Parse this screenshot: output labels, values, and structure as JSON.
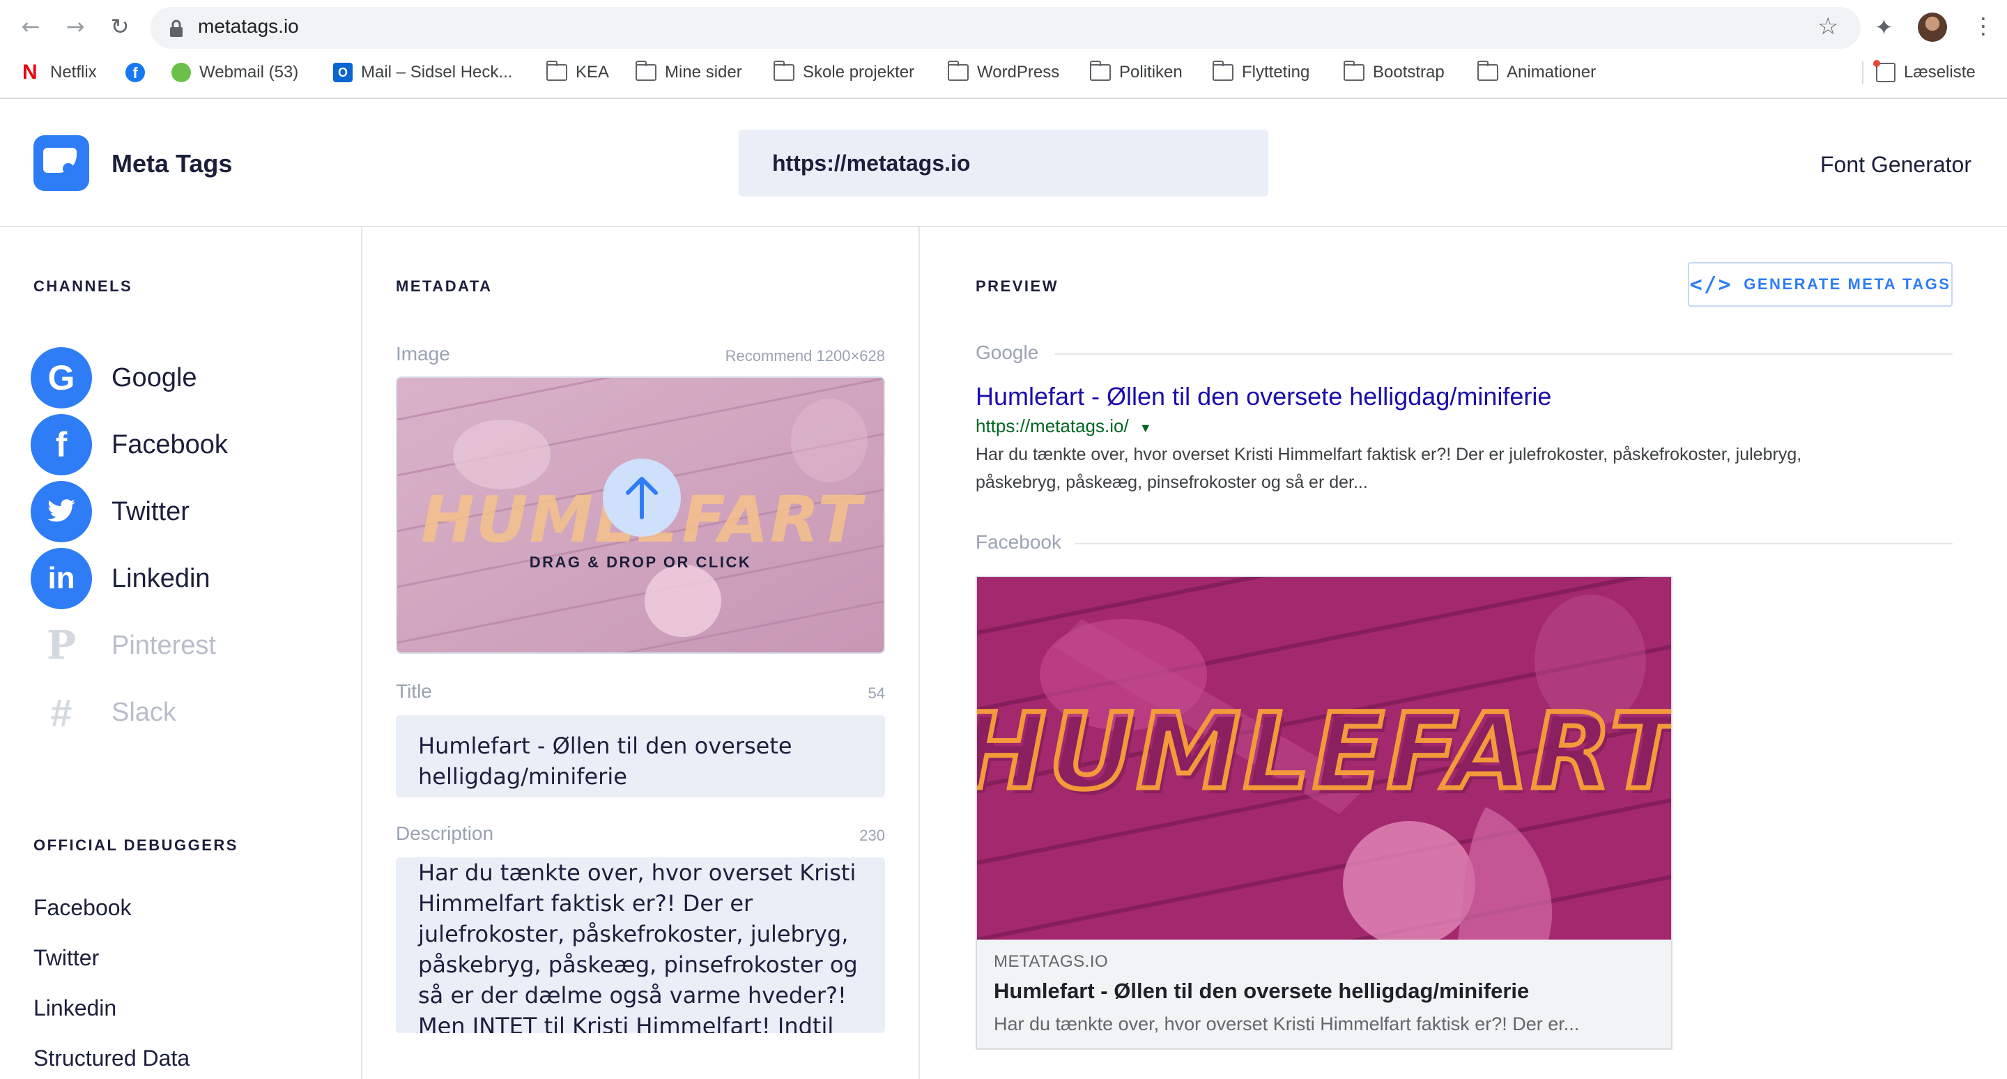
{
  "browser": {
    "url": "metatags.io",
    "bookmarks": [
      {
        "label": "Netflix",
        "icon": "netflix-icon"
      },
      {
        "label": "",
        "icon": "facebook-icon"
      },
      {
        "label": "Webmail (53)",
        "icon": "webmail-icon"
      },
      {
        "label": "Mail – Sidsel Heck...",
        "icon": "outlook-icon"
      },
      {
        "label": "KEA",
        "icon": "folder-icon"
      },
      {
        "label": "Mine sider",
        "icon": "folder-icon"
      },
      {
        "label": "Skole projekter",
        "icon": "folder-icon"
      },
      {
        "label": "WordPress",
        "icon": "folder-icon"
      },
      {
        "label": "Politiken",
        "icon": "folder-icon"
      },
      {
        "label": "Flytteting",
        "icon": "folder-icon"
      },
      {
        "label": "Bootstrap",
        "icon": "folder-icon"
      },
      {
        "label": "Animationer",
        "icon": "folder-icon"
      }
    ],
    "reading_list": "Læseliste"
  },
  "header": {
    "brand": "Meta Tags",
    "url_value": "https://metatags.io",
    "font_generator": "Font Generator"
  },
  "channels": {
    "heading": "CHANNELS",
    "items": [
      {
        "label": "Google",
        "icon": "google-icon",
        "active": true
      },
      {
        "label": "Facebook",
        "icon": "facebook-icon",
        "active": true
      },
      {
        "label": "Twitter",
        "icon": "twitter-icon",
        "active": true
      },
      {
        "label": "Linkedin",
        "icon": "linkedin-icon",
        "active": true
      },
      {
        "label": "Pinterest",
        "icon": "pinterest-icon",
        "active": false
      },
      {
        "label": "Slack",
        "icon": "slack-icon",
        "active": false
      }
    ]
  },
  "debuggers": {
    "heading": "OFFICIAL DEBUGGERS",
    "items": [
      "Facebook",
      "Twitter",
      "Linkedin",
      "Structured Data"
    ]
  },
  "metadata": {
    "heading": "METADATA",
    "image_label": "Image",
    "image_hint": "Recommend 1200×628",
    "upload_text": "DRAG & DROP OR CLICK",
    "image_wordmark": "HUMLEFART",
    "title_label": "Title",
    "title_count": "54",
    "title_value": "Humlefart - Øllen til den oversete helligdag/miniferie",
    "description_label": "Description",
    "description_count": "230",
    "description_value": "Har du tænkte over, hvor overset Kristi Himmelfart faktisk er?! Der er julefrokoster, påskefrokoster, julebryg, påskebryg, påskeæg, pinsefrokoster og så er der dælme også varme hveder?! Men INTET til Kristi Himmelfart!  Indtil nu!"
  },
  "preview": {
    "heading": "PREVIEW",
    "generate_button": "GENERATE META TAGS",
    "google": {
      "section": "Google",
      "title": "Humlefart - Øllen til den oversete helligdag/miniferie",
      "url": "https://metatags.io/",
      "description": "Har du tænkte over, hvor overset Kristi Himmelfart faktisk er?! Der er julefrokoster, påskefrokoster, julebryg, påskebryg, påskeæg, pinsefrokoster og så er der..."
    },
    "facebook": {
      "section": "Facebook",
      "domain": "METATAGS.IO",
      "title": "Humlefart - Øllen til den oversete helligdag/miniferie",
      "description": "Har du tænkte over, hvor overset Kristi Himmelfart faktisk er?! Der er...",
      "image_wordmark": "HUMLEFART"
    }
  },
  "colors": {
    "accent": "#2e7cf6",
    "google_title": "#1a0dab",
    "google_url": "#006621",
    "image_tint": "#b02d78",
    "wordmark": "#f39a3a"
  }
}
